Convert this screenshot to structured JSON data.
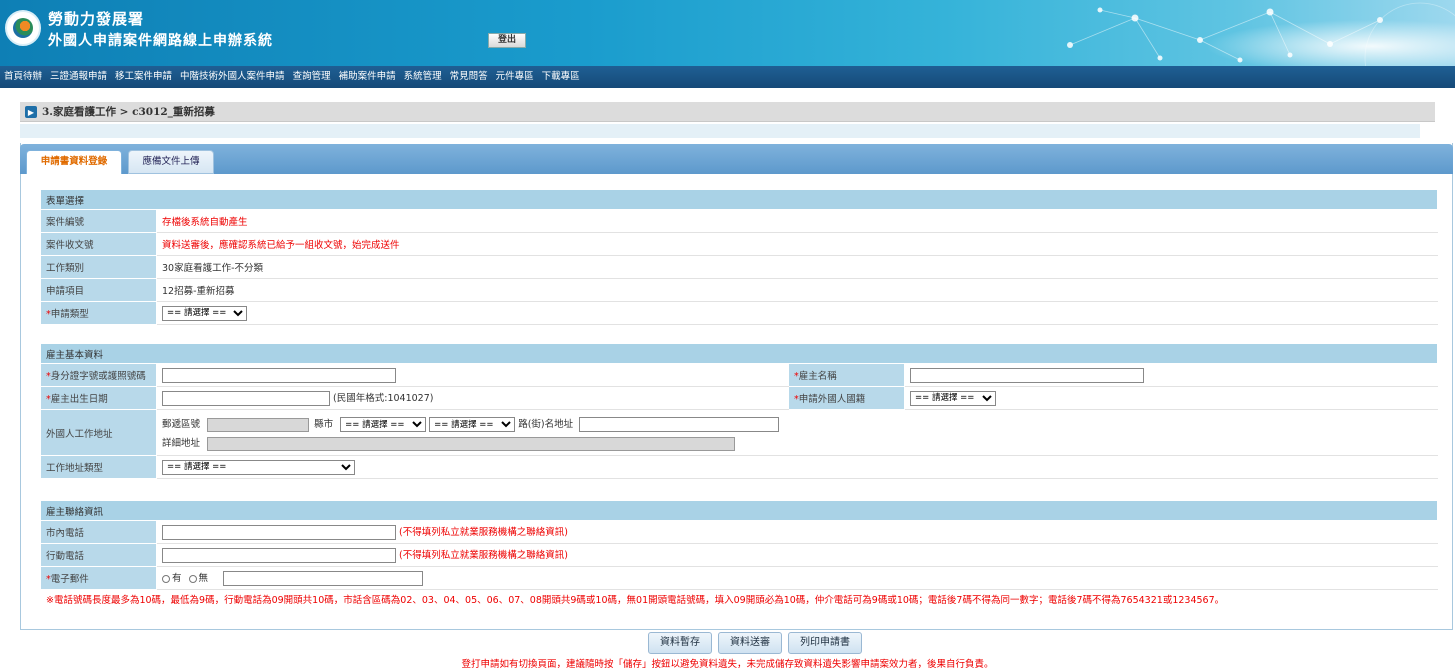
{
  "header": {
    "agency": "勞動力發展署",
    "system_name": "外國人申請案件網路線上申辦系統",
    "logout_label": "登出"
  },
  "menu": [
    "首頁待辦",
    "三證通報申請",
    "移工案件申請",
    "中階技術外國人案件申請",
    "查詢管理",
    "補助案件申請",
    "系統管理",
    "常見問答",
    "元件專區",
    "下載專區"
  ],
  "breadcrumb": "3.家庭看護工作 > c3012_重新招募",
  "tabs": [
    {
      "label": "申請書資料登錄",
      "active": true
    },
    {
      "label": "應備文件上傳",
      "active": false
    }
  ],
  "form_select": {
    "section_title": "表單選擇",
    "case_no_label": "案件編號",
    "case_no_value": "存檔後系統自動產生",
    "receipt_label": "案件收文號",
    "receipt_value": "資料送審後，應確認系統已給予一組收文號，始完成送件",
    "job_type_label": "工作類別",
    "job_type_value": "30家庭看護工作-不分類",
    "apply_item_label": "申請項目",
    "apply_item_value": "12招募-重新招募",
    "apply_type_label": "申請類型",
    "apply_type_select": "== 請選擇 =="
  },
  "employer_basic": {
    "section_title": "雇主基本資料",
    "id_label": "身分證字號或護照號碼",
    "name_label": "雇主名稱",
    "birth_label": "雇主出生日期",
    "birth_hint": "(民國年格式:1041027)",
    "nationality_label": "申請外國人國籍",
    "nationality_select": "== 請選擇 ==",
    "work_address_label": "外國人工作地址",
    "zip_label": "郵遞區號",
    "county_label": "縣市",
    "county_select": "== 請選擇 ==",
    "district_select": "== 請選擇 ==",
    "road_label": "路(街)名地址",
    "detail_label": "詳細地址",
    "addr_type_label": "工作地址類型",
    "addr_type_select": "== 請選擇 =="
  },
  "employer_contact": {
    "section_title": "雇主聯絡資訊",
    "tel_label": "市內電話",
    "tel_hint": "(不得填列私立就業服務機構之聯絡資訊)",
    "mobile_label": "行動電話",
    "mobile_hint": "(不得填列私立就業服務機構之聯絡資訊)",
    "email_label": "電子郵件",
    "email_yes": "有",
    "email_no": "無",
    "phone_note": "※電話號碼長度最多為10碼，最低為9碼，行動電話為09開頭共10碼，市話含區碼為02、03、04、05、06、07、08開頭共9碼或10碼，無01開頭電話號碼，填入09開頭必為10碼，仲介電話可為9碼或10碼；電話後7碼不得為同一數字；電話後7碼不得為7654321或1234567。"
  },
  "buttons": {
    "save": "資料暫存",
    "submit": "資料送審",
    "print": "列印申請書"
  },
  "footnote": "登打申請如有切換頁面，建議隨時按「儲存」按鈕以避免資料遺失，未完成儲存致資料遺失影響申請案效力者，後果自行負責。",
  "colors": {
    "header_blue": "#1a9ccd",
    "menu_navy": "#1f5f94",
    "section_blue": "#a9d2e6",
    "warning_red": "#e00000",
    "active_tab_orange": "#e06b00"
  }
}
